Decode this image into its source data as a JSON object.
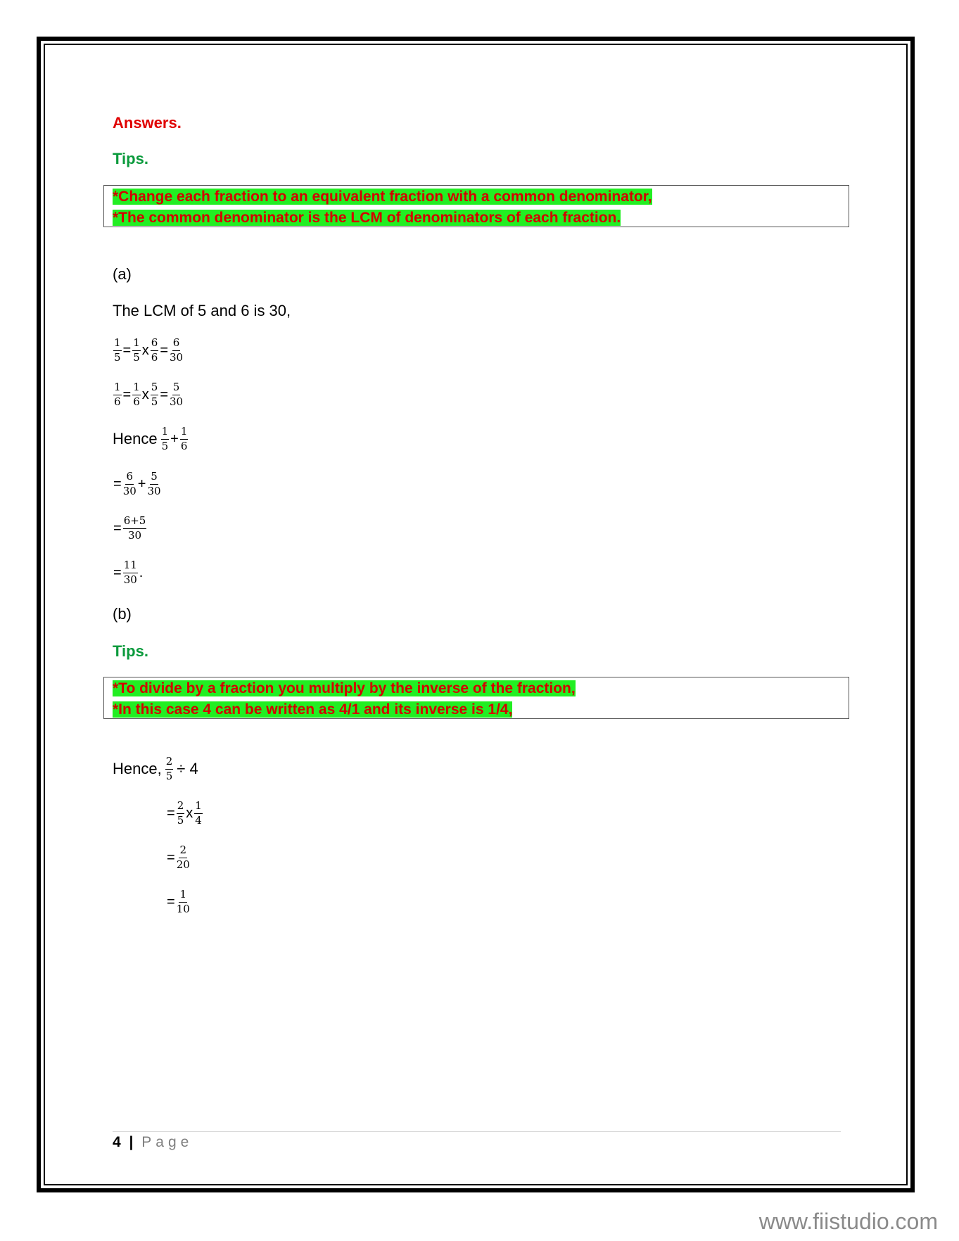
{
  "answers_heading": "Answers.",
  "tips_heading_1": "Tips.",
  "tips_1": [
    "*Change each fraction to an equivalent fraction with a common denominator,",
    "*The common denominator is the LCM of denominators  of each fraction."
  ],
  "part_a": {
    "label": "(a)",
    "lcm_text": "The LCM of 5 and 6 is 30,",
    "eq1": {
      "f1": [
        "1",
        "5"
      ],
      "f2": [
        "1",
        "5"
      ],
      "f3": [
        "6",
        "6"
      ],
      "f4": [
        "6",
        "30"
      ]
    },
    "eq2": {
      "f1": [
        "1",
        "6"
      ],
      "f2": [
        "1",
        "6"
      ],
      "f3": [
        "5",
        "5"
      ],
      "f4": [
        "5",
        "30"
      ]
    },
    "hence_label": "Hence",
    "hence_fracs": {
      "f1": [
        "1",
        "5"
      ],
      "f2": [
        "1",
        "6"
      ]
    },
    "step1": {
      "f1": [
        "6",
        "30"
      ],
      "f2": [
        "5",
        "30"
      ]
    },
    "step2": [
      "6+5",
      "30"
    ],
    "step3": [
      "11",
      "30"
    ]
  },
  "part_b": {
    "label": "(b)",
    "tips_heading": "Tips.",
    "tips": [
      "*To divide by a fraction you multiply by the inverse of the fraction,",
      "*In this case 4 can be written as 4/1 and its inverse is 1/4,"
    ],
    "hence_label": "Hence,",
    "hence_frac": [
      "2",
      "5"
    ],
    "hence_divisor": "÷ 4",
    "step1": {
      "f1": [
        "2",
        "5"
      ],
      "f2": [
        "1",
        "4"
      ]
    },
    "step2": [
      "2",
      "20"
    ],
    "step3": [
      "1",
      "10"
    ]
  },
  "footer": {
    "page_number": "4",
    "separator": "|",
    "label": "Page"
  },
  "watermark": "www.fiistudio.com"
}
